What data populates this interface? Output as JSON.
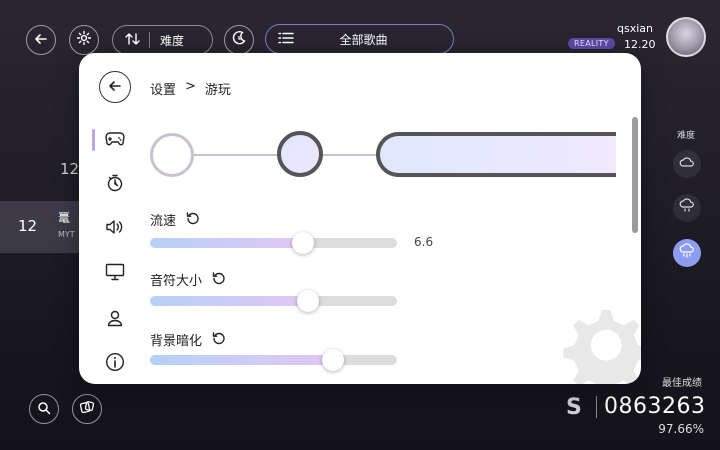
{
  "topbar": {
    "difficulty_label": "难度",
    "song_filter_label": "全部歌曲"
  },
  "songlist": {
    "rows": [
      {
        "level": "12"
      },
      {
        "level": "12",
        "title": "鼍",
        "subtitle": "MYT"
      }
    ]
  },
  "user": {
    "name": "qsxian",
    "badge": "REALITY",
    "rks": "12.20"
  },
  "difficulty": {
    "title": "难度",
    "icons": [
      "cloud-icon",
      "cloud-drizzle-icon",
      "cloud-rain-icon"
    ],
    "selected_index": 2
  },
  "record": {
    "label": "最佳成绩",
    "rank": "S",
    "score": "0863263",
    "accuracy": "97.66%"
  },
  "settings": {
    "breadcrumb_root": "设置",
    "breadcrumb_sep": ">",
    "breadcrumb_page": "游玩",
    "nav_icons": [
      "gamepad-icon",
      "timer-icon",
      "speaker-icon",
      "display-icon",
      "person-icon",
      "info-icon"
    ],
    "active_nav": 0,
    "sliders": [
      {
        "label": "流速",
        "fraction": 0.62,
        "value": "6.6"
      },
      {
        "label": "音符大小",
        "fraction": 0.64
      },
      {
        "label": "背景暗化",
        "fraction": 0.74
      }
    ]
  },
  "colors": {
    "accent_fill_start": "#b5d1f7",
    "accent_fill_end": "#e3c7f4",
    "reality_badge": "#5b4aa3",
    "selected_difficulty": "#8c9cf0"
  }
}
